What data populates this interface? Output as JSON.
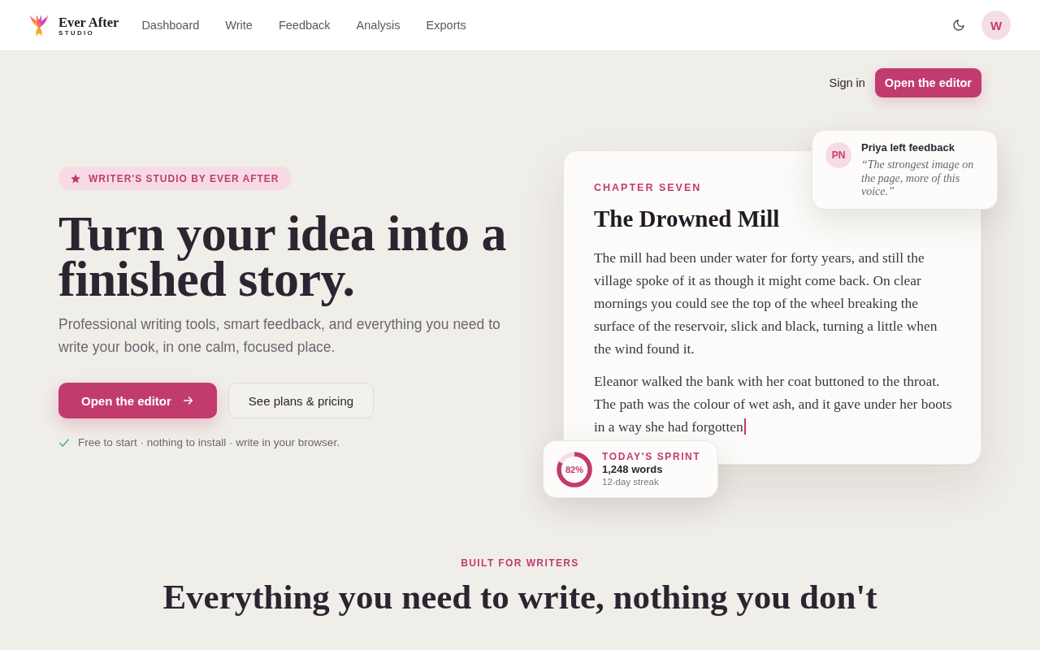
{
  "header": {
    "brand": {
      "name": "Ever After",
      "tagline": "STUDIO"
    },
    "nav": [
      {
        "label": "Dashboard",
        "selected": false
      },
      {
        "label": "Write",
        "selected": false
      },
      {
        "label": "Feedback",
        "selected": false
      },
      {
        "label": "Analysis",
        "selected": false
      },
      {
        "label": "Exports",
        "selected": false
      }
    ],
    "avatar": "W"
  },
  "auth": {
    "sign_in": "Sign in",
    "cta": "Open the editor"
  },
  "hero": {
    "badge": "WRITER'S STUDIO BY EVER AFTER",
    "title": "Turn your idea into a finished story.",
    "subtitle": "Professional writing tools, smart feedback, and everything you need to write your book, in one calm, focused place.",
    "buttons": [
      {
        "label": "Open the editor",
        "kind": "primary"
      },
      {
        "label": "See plans & pricing",
        "kind": "secondary"
      }
    ],
    "note": "Free to start · nothing to install · write in your browser."
  },
  "editor": {
    "chapter": "CHAPTER SEVEN",
    "title": "The Drowned Mill",
    "paragraphs": [
      "The mill had been under water for forty years, and still the village spoke of it as though it might come back. On clear mornings you could see the top of the wheel breaking the surface of the reservoir, slick and black, turning a little when the wind found it.",
      "Eleanor walked the bank with her coat buttoned to the throat. The path was the colour of wet ash, and it gave under her boots in a way she had forgotten"
    ]
  },
  "feedback": {
    "initials": "PN",
    "title": "Priya left feedback",
    "quote": "“The strongest image on the page, more of this voice.”"
  },
  "sprint": {
    "level": 0.82,
    "percent": "82%",
    "label": "TODAY'S SPRINT",
    "words": "1,248 words",
    "streak": "12-day streak"
  },
  "features": {
    "eyebrow": "BUILT FOR WRITERS",
    "title": "Everything you need to write, nothing you don't"
  }
}
